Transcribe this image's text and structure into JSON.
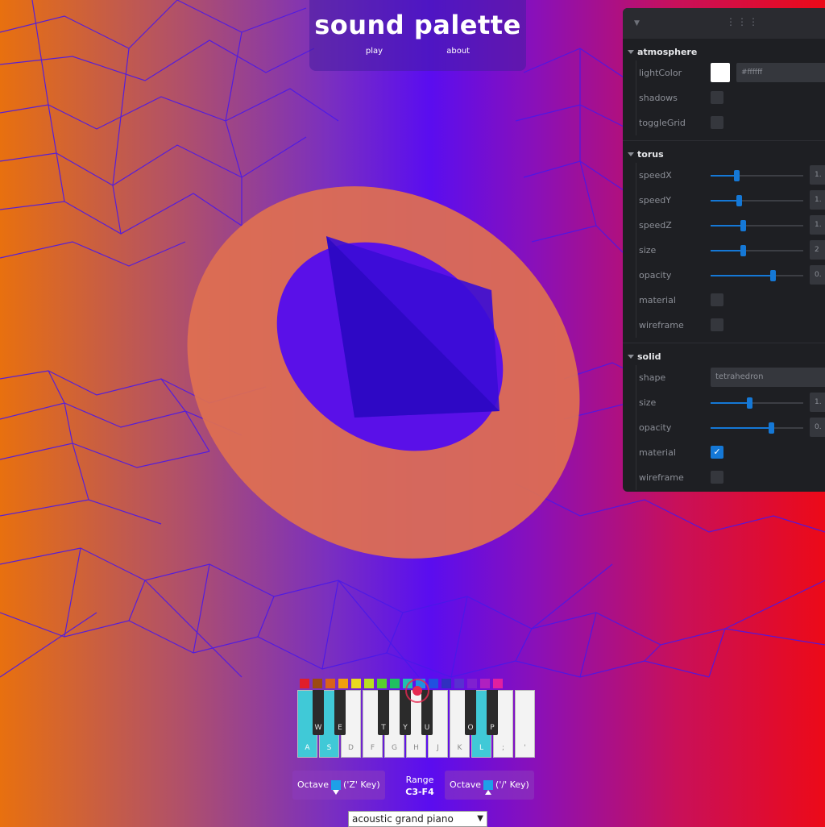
{
  "header": {
    "title": "sound palette",
    "nav": [
      "play",
      "about"
    ]
  },
  "panel": {
    "atmosphere": {
      "title": "atmosphere",
      "lightColor_label": "lightColor",
      "lightColor_value": "#ffffff",
      "shadows_label": "shadows",
      "toggleGrid_label": "toggleGrid"
    },
    "torus": {
      "title": "torus",
      "rows": [
        {
          "label": "speedX",
          "value": "1.",
          "fraction": 0.28
        },
        {
          "label": "speedY",
          "value": "1.",
          "fraction": 0.3
        },
        {
          "label": "speedZ",
          "value": "1.",
          "fraction": 0.35
        },
        {
          "label": "size",
          "value": "2",
          "fraction": 0.35
        },
        {
          "label": "opacity",
          "value": "0.",
          "fraction": 0.67
        }
      ],
      "material_label": "material",
      "wireframe_label": "wireframe"
    },
    "solid": {
      "title": "solid",
      "shape_label": "shape",
      "shape_value": "tetrahedron",
      "rows": [
        {
          "label": "size",
          "value": "1.",
          "fraction": 0.42
        },
        {
          "label": "opacity",
          "value": "0.",
          "fraction": 0.65
        }
      ],
      "material_label": "material",
      "wireframe_label": "wireframe",
      "checkmark": "✓"
    }
  },
  "colors": [
    "#e01e2a",
    "#9c4a10",
    "#d9621a",
    "#f0a010",
    "#e8d820",
    "#b8e020",
    "#58d030",
    "#20c060",
    "#20c0b0",
    "#2090e0",
    "#2050e0",
    "#3030c0",
    "#5830d0",
    "#8020d0",
    "#b020c0",
    "#e020a0"
  ],
  "piano": {
    "white_keys": [
      {
        "label": "A",
        "lit": true
      },
      {
        "label": "S",
        "lit": true
      },
      {
        "label": "D",
        "lit": false
      },
      {
        "label": "F",
        "lit": false
      },
      {
        "label": "G",
        "lit": false
      },
      {
        "label": "H",
        "lit": false
      },
      {
        "label": "J",
        "lit": false
      },
      {
        "label": "K",
        "lit": false
      },
      {
        "label": "L",
        "lit": true
      },
      {
        "label": ";",
        "lit": false
      },
      {
        "label": "'",
        "lit": false
      }
    ],
    "black_keys": [
      "W",
      "E",
      "T",
      "Y",
      "U",
      "O",
      "P"
    ]
  },
  "controls": {
    "octave_down": "Octave",
    "octave_down_hint": "('Z' Key)",
    "range_label": "Range",
    "range_value": "C3-F4",
    "octave_up": "Octave",
    "octave_up_hint": "('/' Key)",
    "instrument": "acoustic grand piano"
  }
}
